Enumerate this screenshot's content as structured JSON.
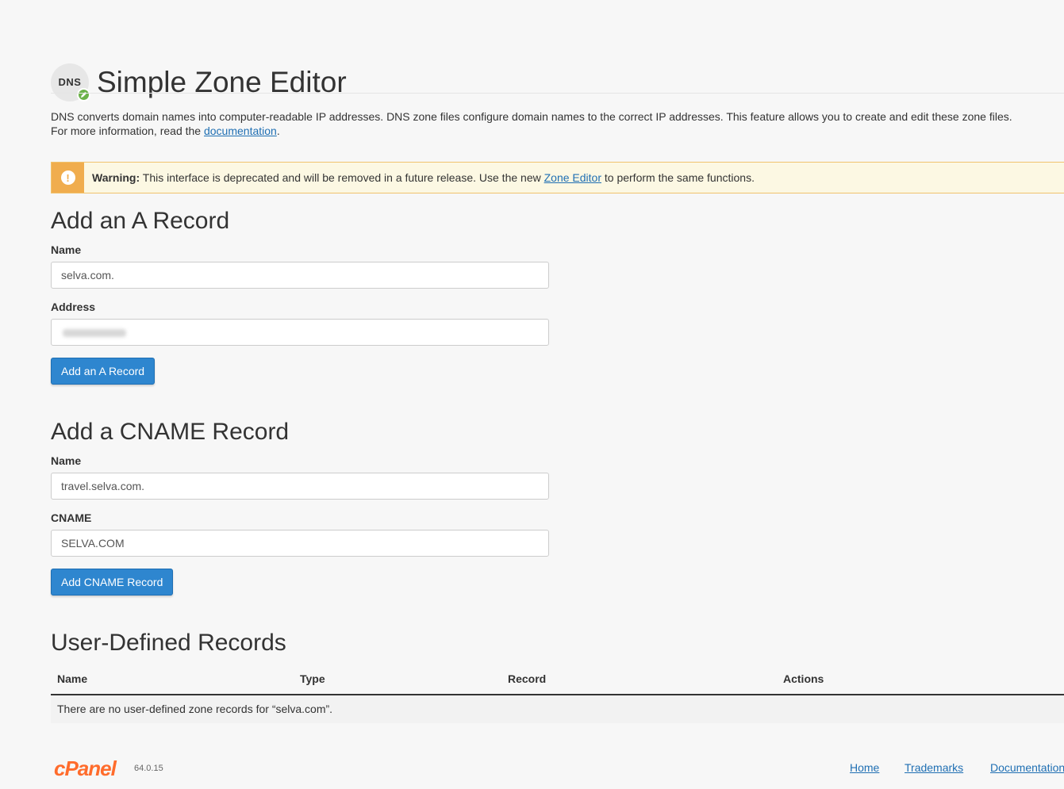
{
  "header": {
    "icon_text": "DNS",
    "title": "Simple Zone Editor"
  },
  "intro": {
    "text": "DNS converts domain names into computer-readable IP addresses. DNS zone files configure domain names to the correct IP addresses. This feature allows you to create and edit these zone files.",
    "more_prefix": "For more information, read the ",
    "doc_link": "documentation",
    "more_suffix": "."
  },
  "warning": {
    "icon": "!",
    "label": "Warning:",
    "text_before": " This interface is deprecated and will be removed in a future release. Use the new ",
    "link": "Zone Editor",
    "text_after": " to perform the same functions."
  },
  "a_record": {
    "heading": "Add an A Record",
    "name_label": "Name",
    "name_value": "selva.com.",
    "address_label": "Address",
    "address_value": "",
    "button": "Add an A Record"
  },
  "cname_record": {
    "heading": "Add a CNAME Record",
    "name_label": "Name",
    "name_value": "travel.selva.com.",
    "cname_label": "CNAME",
    "cname_value": "SELVA.COM",
    "button": "Add CNAME Record"
  },
  "records": {
    "heading": "User-Defined Records",
    "columns": [
      "Name",
      "Type",
      "Record",
      "Actions"
    ],
    "empty_message": "There are no user-defined zone records for “selva.com”."
  },
  "footer": {
    "logo": "cPanel",
    "version": "64.0.15",
    "links": [
      "Home",
      "Trademarks",
      "Documentation"
    ]
  }
}
